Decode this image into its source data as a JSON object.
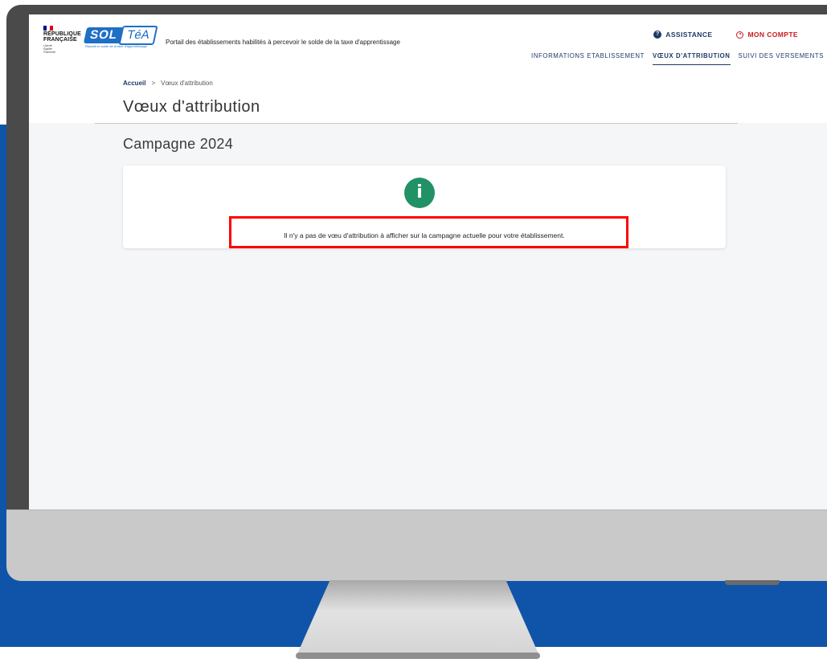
{
  "header": {
    "rf_line1": "RÉPUBLIQUE",
    "rf_line2": "FRANÇAISE",
    "rf_motto": "Liberté Égalité Fraternité",
    "logo_sol": "SOL",
    "logo_tea": "TéA",
    "logo_tagline": "Répartir le solde de la taxe d'apprentissage",
    "portal_text": "Portail des établissements habilités à percevoir le solde de la taxe d'apprentissage",
    "assistance_label": "ASSISTANCE",
    "account_label": "MON COMPTE",
    "assist_icon": "?"
  },
  "nav": {
    "items": [
      {
        "label": "INFORMATIONS ETABLISSEMENT"
      },
      {
        "label": "VŒUX D'ATTRIBUTION"
      },
      {
        "label": "SUIVI DES VERSEMENTS"
      }
    ]
  },
  "breadcrumb": {
    "home": "Accueil",
    "separator": ">",
    "current": "Vœux d'attribution"
  },
  "main": {
    "page_title": "Vœux d'attribution",
    "campaign_title": "Campagne 2024",
    "info_icon": "i",
    "info_message": "Il n'y a pas de vœu d'attribution à afficher sur la campagne actuelle pour votre établissement."
  },
  "colors": {
    "background_blue": "#0f54a8",
    "brand_blue": "#1f6fc5",
    "nav_blue": "#1d3a66",
    "account_red": "#c9191e",
    "info_green": "#229266",
    "highlight_red": "#ff0000"
  }
}
